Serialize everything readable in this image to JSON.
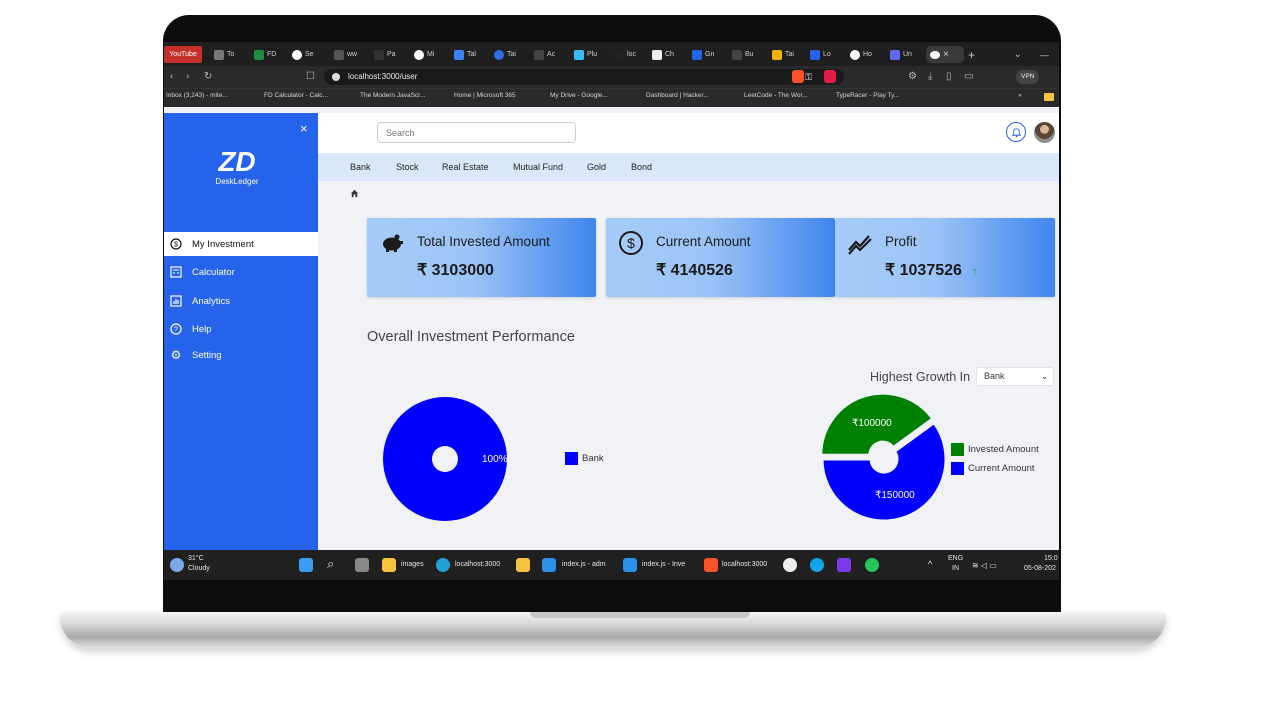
{
  "browser": {
    "tabs": [
      "YouTube",
      "To",
      "FD",
      "Se",
      "ww",
      "Pa",
      "Mi",
      "Tal",
      "Tai",
      "Ac",
      "Plu",
      "loc",
      "Ch",
      "Gn",
      "Bu",
      "Tai",
      "Lo",
      "Ho",
      "Un"
    ],
    "active_tab_close": "×",
    "new_tab": "+",
    "url": "localhost:3000/user",
    "vpn_label": "VPN",
    "bookmarks": [
      "Inbox (3,243) - mite...",
      "FD Calculator - Calc...",
      "The Modern JavaScr...",
      "Home | Microsoft 365",
      "My Drive - Google...",
      "Dashboard | Hacker...",
      "LeetCode - The Wor...",
      "TypeRacer - Play Ty..."
    ],
    "bookmarks_more": "»"
  },
  "sidebar": {
    "close_icon": "×",
    "logo_mark": "ZD",
    "logo_name": "DeskLedger",
    "items": [
      {
        "label": "My Investment",
        "icon": "dollar-circle-icon",
        "active": true
      },
      {
        "label": "Calculator",
        "icon": "calculator-icon",
        "active": false
      },
      {
        "label": "Analytics",
        "icon": "analytics-icon",
        "active": false
      },
      {
        "label": "Help",
        "icon": "help-icon",
        "active": false
      },
      {
        "label": "Setting",
        "icon": "gear-icon",
        "active": false
      }
    ]
  },
  "header": {
    "search_placeholder": "Search"
  },
  "categories": [
    "Bank",
    "Stock",
    "Real Estate",
    "Mutual Fund",
    "Gold",
    "Bond"
  ],
  "cards": [
    {
      "title": "Total Invested Amount",
      "value": "₹ 3103000",
      "icon": "piggy-bank-icon"
    },
    {
      "title": "Current Amount",
      "value": "₹ 4140526",
      "icon": "dollar-circle-icon"
    },
    {
      "title": "Profit",
      "value": "₹ 1037526",
      "icon": "trend-up-icon",
      "trend": "↑"
    }
  ],
  "section_title": "Overall Investment Performance",
  "highest_growth": {
    "label": "Highest Growth In",
    "selected": "Bank"
  },
  "chart_data": [
    {
      "type": "pie",
      "categories": [
        "Bank"
      ],
      "values": [
        100
      ],
      "labels": [
        "100%"
      ],
      "colors": [
        "#0000ff"
      ],
      "legend": [
        "Bank"
      ]
    },
    {
      "type": "pie",
      "categories": [
        "Invested Amount",
        "Current Amount"
      ],
      "values": [
        100000,
        150000
      ],
      "labels": [
        "₹100000",
        "₹150000"
      ],
      "colors": [
        "#008000",
        "#0000ff"
      ],
      "legend": [
        "Invested Amount",
        "Current Amount"
      ]
    }
  ],
  "taskbar": {
    "weather_temp": "31°C",
    "weather_text": "Cloudy",
    "apps": [
      "images",
      "localhost:3000",
      "index.js - adm",
      "index.js - Inve",
      "localhost:3000"
    ],
    "lang_top": "ENG",
    "lang_bottom": "IN",
    "time": "15:0",
    "date": "05-08-202"
  }
}
